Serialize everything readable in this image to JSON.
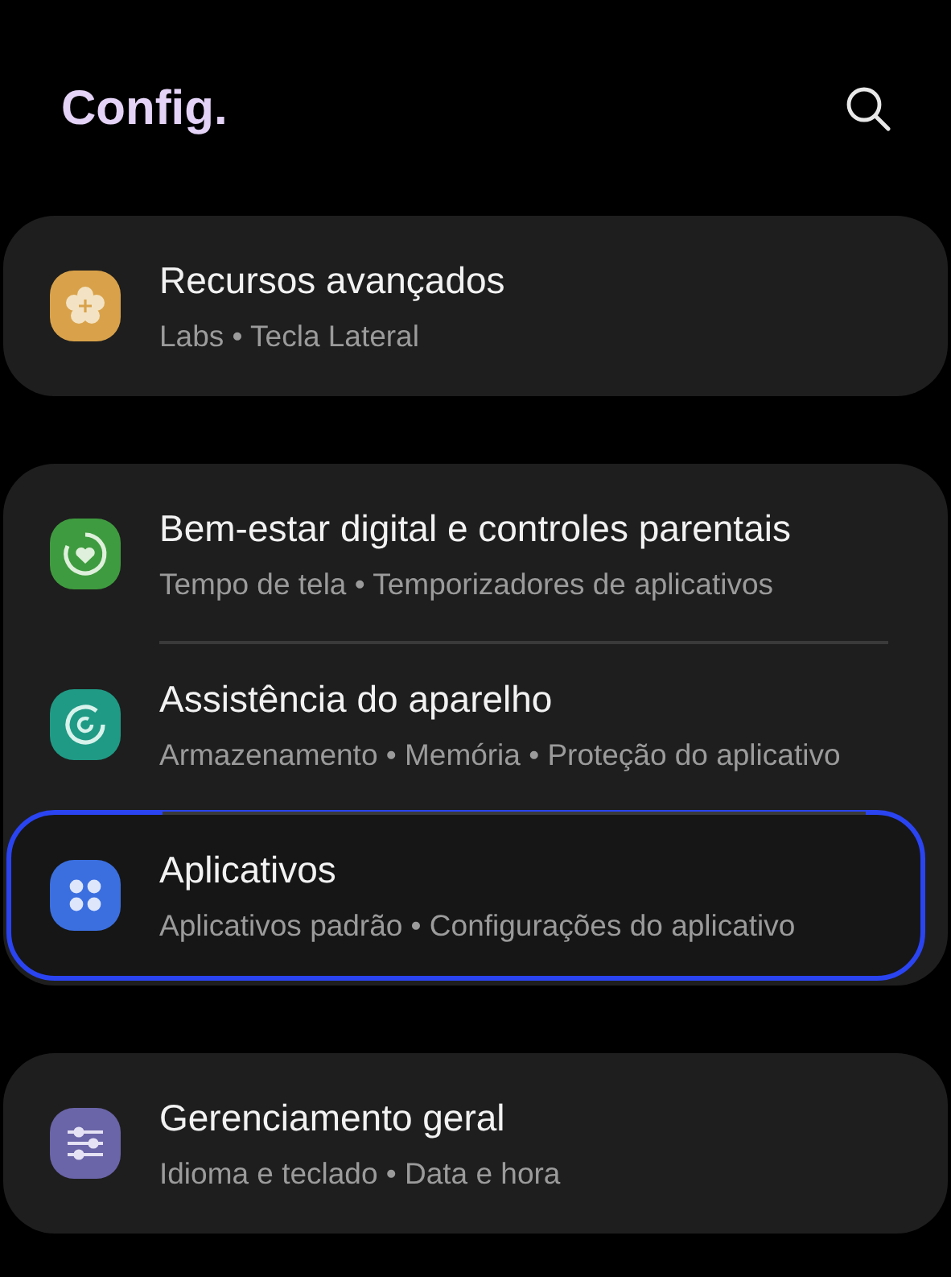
{
  "header": {
    "title": "Config."
  },
  "groups": [
    {
      "items": [
        {
          "title": "Recursos avançados",
          "subtitle": "Labs • Tecla Lateral",
          "kind": "flower",
          "color": "#d9a24a",
          "selected": false
        }
      ]
    },
    {
      "items": [
        {
          "title": "Bem-estar digital e controles parentais",
          "subtitle": "Tempo de tela • Temporizadores de aplicativos",
          "kind": "heart",
          "color": "#3f9b3f",
          "selected": false
        },
        {
          "title": "Assistência do aparelho",
          "subtitle": "Armazenamento • Memória • Proteção do aplicativo",
          "kind": "refresh",
          "color": "#1f9a85",
          "selected": false
        },
        {
          "title": "Aplicativos",
          "subtitle": "Aplicativos padrão • Configurações do aplicativo",
          "kind": "dots",
          "color": "#3b6fe0",
          "selected": true
        }
      ]
    },
    {
      "items": [
        {
          "title": "Gerenciamento geral",
          "subtitle": "Idioma e teclado • Data e hora",
          "kind": "sliders",
          "color": "#6a64a8",
          "selected": false
        }
      ]
    }
  ]
}
